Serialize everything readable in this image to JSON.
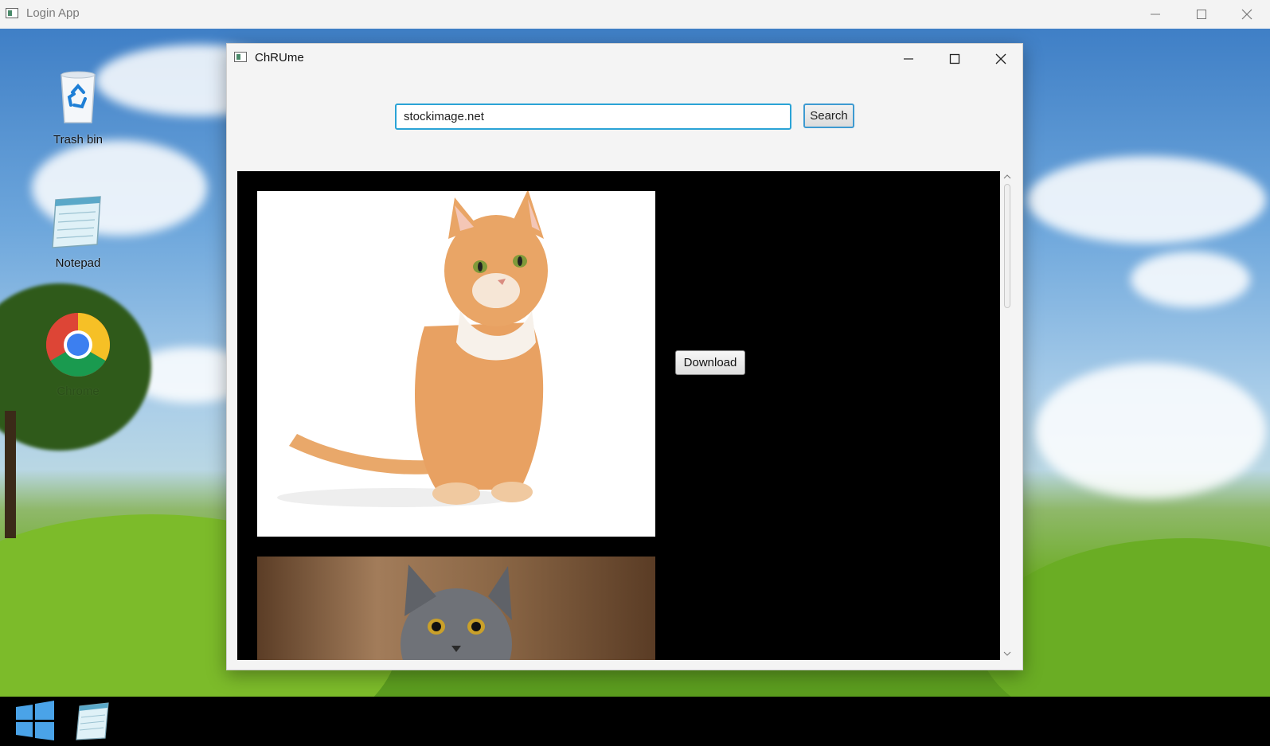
{
  "outer_window": {
    "title": "Login App"
  },
  "desktop": {
    "icons": [
      {
        "label": "Trash bin",
        "icon": "recycle-bin-icon"
      },
      {
        "label": "Notepad",
        "icon": "notepad-icon"
      },
      {
        "label": "Chrome",
        "icon": "chrome-icon"
      }
    ]
  },
  "browser_window": {
    "title": "ChRUme",
    "url_value": "stockimage.net",
    "search_label": "Search",
    "download_label": "Download",
    "results": [
      {
        "subject": "orange tabby cat on white background"
      },
      {
        "subject": "grey cat on wooden background"
      }
    ]
  },
  "taskbar": {
    "items": [
      {
        "icon": "windows-start-icon"
      },
      {
        "icon": "notepad-icon"
      }
    ]
  },
  "colors": {
    "input_focus_border": "#2aa3d6",
    "results_background": "#000000",
    "taskbar_background": "#000000"
  }
}
